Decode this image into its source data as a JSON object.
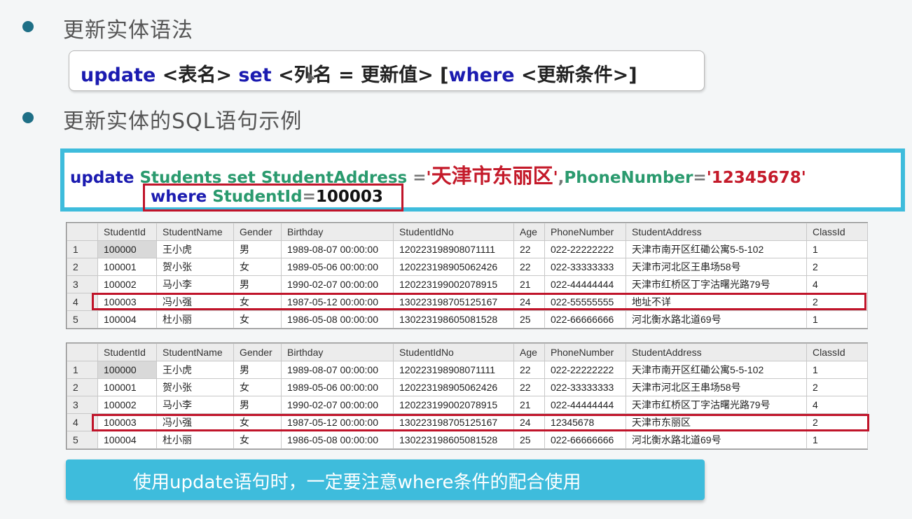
{
  "bullets": [
    {
      "text": "更新实体语法"
    },
    {
      "text": "更新实体的SQL语句示例"
    }
  ],
  "syntax": {
    "update": "update",
    "table": "<表名>",
    "set": "set",
    "assign": "<列名 = 更新值>",
    "open_bracket": "[",
    "where": "where",
    "cond": "<更新条件>",
    "close_bracket": "]"
  },
  "example": {
    "update": "update",
    "table": "Students",
    "set": "set",
    "col1": "StudentAddress",
    "eq1": "=",
    "q1": "'",
    "val1": "天津市东丽区",
    "q2": "'",
    "comma": ",",
    "col2": "PhoneNumber",
    "eq2": "=",
    "val2": "'12345678'",
    "where": "where",
    "key": "StudentId",
    "eq3": "=",
    "key_val": "100003"
  },
  "columns": [
    "",
    "StudentId",
    "StudentName",
    "Gender",
    "Birthday",
    "StudentIdNo",
    "Age",
    "PhoneNumber",
    "StudentAddress",
    "ClassId"
  ],
  "table_before": [
    [
      "1",
      "100000",
      "王小虎",
      "男",
      "1989-08-07 00:00:00",
      "120223198908071111",
      "22",
      "022-22222222",
      "天津市南开区红磡公寓5-5-102",
      "1"
    ],
    [
      "2",
      "100001",
      "贺小张",
      "女",
      "1989-05-06 00:00:00",
      "120223198905062426",
      "22",
      "022-33333333",
      "天津市河北区王串场58号",
      "2"
    ],
    [
      "3",
      "100002",
      "马小李",
      "男",
      "1990-02-07 00:00:00",
      "120223199002078915",
      "21",
      "022-44444444",
      "天津市红桥区丁字沽曙光路79号",
      "4"
    ],
    [
      "4",
      "100003",
      "冯小强",
      "女",
      "1987-05-12 00:00:00",
      "130223198705125167",
      "24",
      "022-55555555",
      "地址不详",
      "2"
    ],
    [
      "5",
      "100004",
      "杜小丽",
      "女",
      "1986-05-08 00:00:00",
      "130223198605081528",
      "25",
      "022-66666666",
      "河北衡水路北道69号",
      "1"
    ]
  ],
  "table_after": [
    [
      "1",
      "100000",
      "王小虎",
      "男",
      "1989-08-07 00:00:00",
      "120223198908071111",
      "22",
      "022-22222222",
      "天津市南开区红磡公寓5-5-102",
      "1"
    ],
    [
      "2",
      "100001",
      "贺小张",
      "女",
      "1989-05-06 00:00:00",
      "120223198905062426",
      "22",
      "022-33333333",
      "天津市河北区王串场58号",
      "2"
    ],
    [
      "3",
      "100002",
      "马小李",
      "男",
      "1990-02-07 00:00:00",
      "120223199002078915",
      "21",
      "022-44444444",
      "天津市红桥区丁字沽曙光路79号",
      "4"
    ],
    [
      "4",
      "100003",
      "冯小强",
      "女",
      "1987-05-12 00:00:00",
      "130223198705125167",
      "24",
      "12345678",
      "天津市东丽区",
      "2"
    ],
    [
      "5",
      "100004",
      "杜小丽",
      "女",
      "1986-05-08 00:00:00",
      "130223198605081528",
      "25",
      "022-66666666",
      "河北衡水路北道69号",
      "1"
    ]
  ],
  "note": "使用update语句时，一定要注意where条件的配合使用",
  "colors": {
    "accent": "#3ebcdc",
    "highlight": "#c0142a",
    "keyword": "#1b1bb0",
    "identifier": "#2a9a6e"
  }
}
